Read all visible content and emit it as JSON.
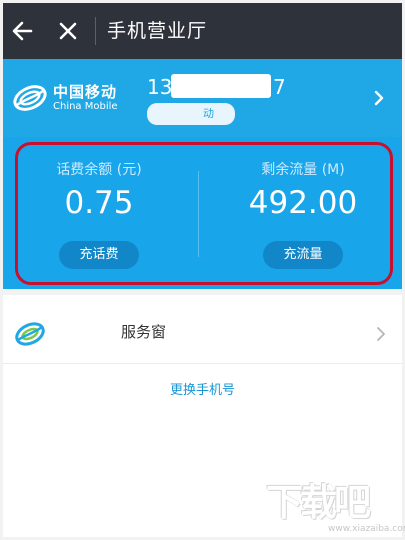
{
  "nav": {
    "title": "手机营业厅",
    "back_icon": "arrow-left-icon",
    "close_icon": "close-icon"
  },
  "account": {
    "brand_cn": "中国移动",
    "brand_en": "China Mobile",
    "phone_prefix": "13",
    "phone_suffix": "7",
    "sub_suffix": "动",
    "logo_icon": "china-mobile-logo",
    "chevron_icon": "chevron-right-icon"
  },
  "balance": {
    "fee_label": "话费余额 (元)",
    "fee_value": "0.75",
    "fee_button": "充话费",
    "data_label": "剩余流量 (M)",
    "data_value": "492.00",
    "data_button": "充流量"
  },
  "service": {
    "label": "服务窗",
    "link": "更换手机号",
    "chevron_icon": "chevron-right-icon"
  },
  "watermark": {
    "text": "下载吧",
    "url": "www.xiazaiba.com"
  },
  "colors": {
    "nav_bg": "#2e323b",
    "accent_blue": "#1fa7e6",
    "button_blue": "#1187c9",
    "highlight_red": "#c8102e",
    "link_blue": "#1996d6"
  }
}
